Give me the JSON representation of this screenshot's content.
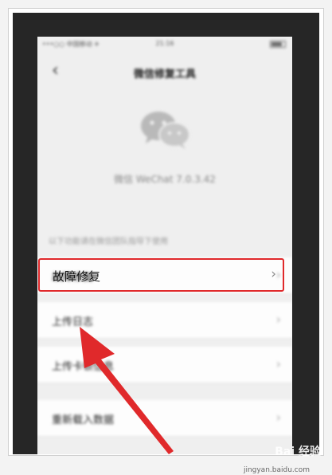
{
  "status_bar": {
    "carrier": "•••○○ 中国移动 ✈",
    "time": "21:16"
  },
  "nav": {
    "back_glyph": "‹",
    "title": "微信修复工具"
  },
  "app": {
    "version": "微信 WeChat 7.0.3.42",
    "hint": "以下功能请在微信团队指导下使用"
  },
  "menu": [
    {
      "label": "故障修复",
      "chevron": "›"
    },
    {
      "label": "上传日志",
      "chevron": "›"
    },
    {
      "label": "上传卡顿信息",
      "chevron": "›"
    },
    {
      "label": "重新载入数据",
      "chevron": "›"
    }
  ],
  "highlight": {
    "label": "故障修复",
    "chevron": "›",
    "color": "#e0292b"
  },
  "watermark": {
    "brand": "Bai 经验",
    "url": "jingyan.baidu.com"
  },
  "icons": {
    "logo": "wechat-logo-icon",
    "arrow": "red-arrow-icon"
  }
}
